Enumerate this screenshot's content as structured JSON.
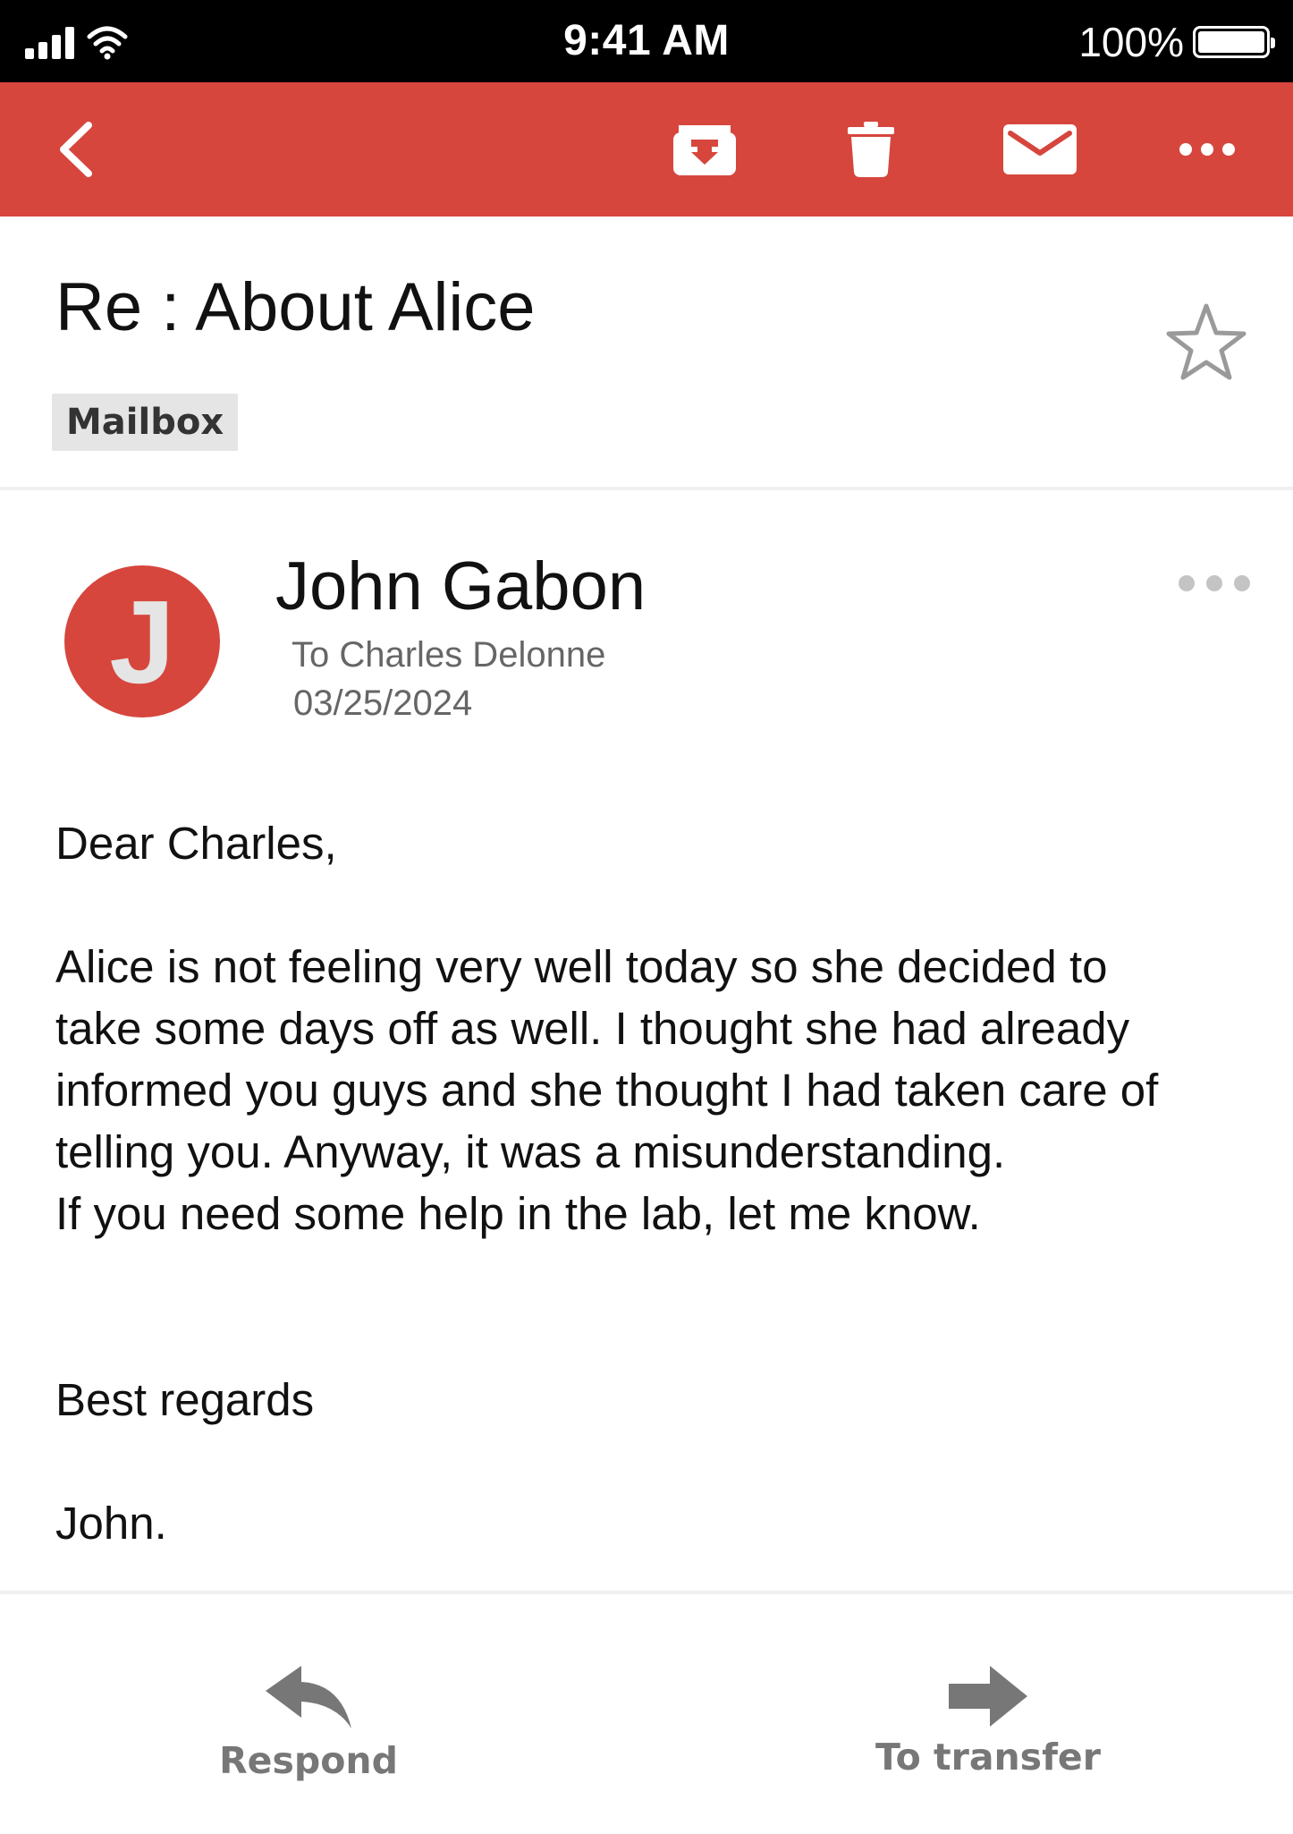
{
  "status_bar": {
    "time": "9:41 AM",
    "battery_text": "100%",
    "battery_level": 1.0
  },
  "toolbar": {
    "icons": [
      "back-chevron-icon",
      "archive-icon",
      "trash-icon",
      "mail-icon",
      "more-horizontal-icon"
    ],
    "color": "#d6463d"
  },
  "email": {
    "subject": "Re : About Alice",
    "label": "Mailbox",
    "sender": {
      "initial": "J",
      "name": "John Gabon",
      "to": "To Charles Delonne",
      "date": "03/25/2024"
    },
    "body": {
      "greeting": "Dear Charles,",
      "paragraph_lines": [
        "Alice is not feeling very well today so she decided to",
        "take some days off as well. I thought she had already",
        "informed you guys and she thought I had taken care of",
        "telling you. Anyway, it was a misunderstanding.",
        "If you need some help in the lab, let me know."
      ],
      "closing": "Best regards",
      "signature": "John."
    }
  },
  "actions": {
    "respond_label": "Respond",
    "transfer_label": "To transfer"
  },
  "colors": {
    "accent": "#d6463d",
    "status_bar": "#000000",
    "secondary_text": "#666666",
    "action_gray": "#777777"
  }
}
